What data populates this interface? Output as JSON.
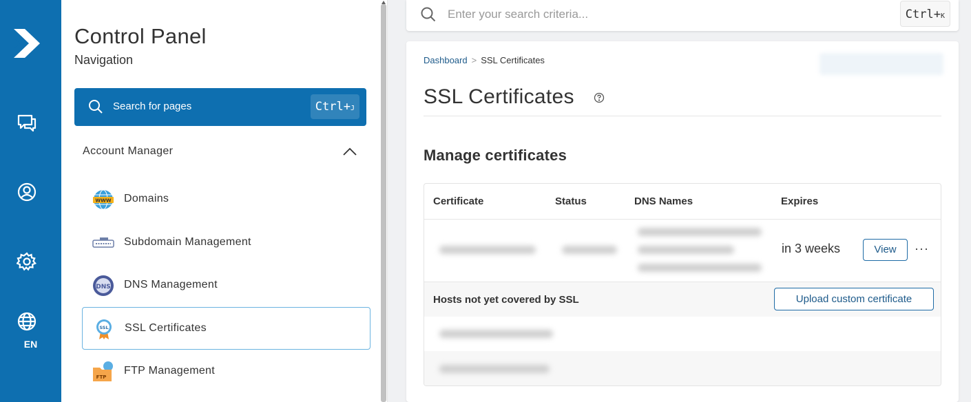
{
  "rail": {
    "lang_label": "EN",
    "icons": [
      "logo-icon",
      "chat-icon",
      "user-icon",
      "gear-icon",
      "globe-icon"
    ]
  },
  "nav": {
    "title": "Control Panel",
    "subtitle": "Navigation",
    "search_label": "Search for pages",
    "search_shortcut_ctrl": "Ctrl+",
    "search_shortcut_key": "J",
    "section_label": "Account Manager",
    "items": [
      {
        "label": "Domains",
        "icon": "www-globe-icon"
      },
      {
        "label": "Subdomain Management",
        "icon": "subdomain-icon"
      },
      {
        "label": "DNS Management",
        "icon": "dns-icon"
      },
      {
        "label": "SSL Certificates",
        "icon": "ssl-badge-icon",
        "active": true
      },
      {
        "label": "FTP Management",
        "icon": "ftp-folder-icon"
      }
    ]
  },
  "topsearch": {
    "placeholder": "Enter your search criteria...",
    "shortcut_ctrl": "Ctrl+",
    "shortcut_key": "K"
  },
  "main": {
    "breadcrumb": {
      "home": "Dashboard",
      "separator": ">",
      "current": "SSL Certificates"
    },
    "title": "SSL Certificates",
    "section_title": "Manage certificates",
    "table": {
      "headers": [
        "Certificate",
        "Status",
        "DNS Names",
        "Expires"
      ],
      "row": {
        "expires": "in 3 weeks",
        "view_label": "View",
        "more_label": "···"
      },
      "hosts_label": "Hosts not yet covered by SSL",
      "upload_label": "Upload custom certificate"
    }
  },
  "colors": {
    "brand": "#0e6fb0",
    "link": "#1d5a8a"
  }
}
